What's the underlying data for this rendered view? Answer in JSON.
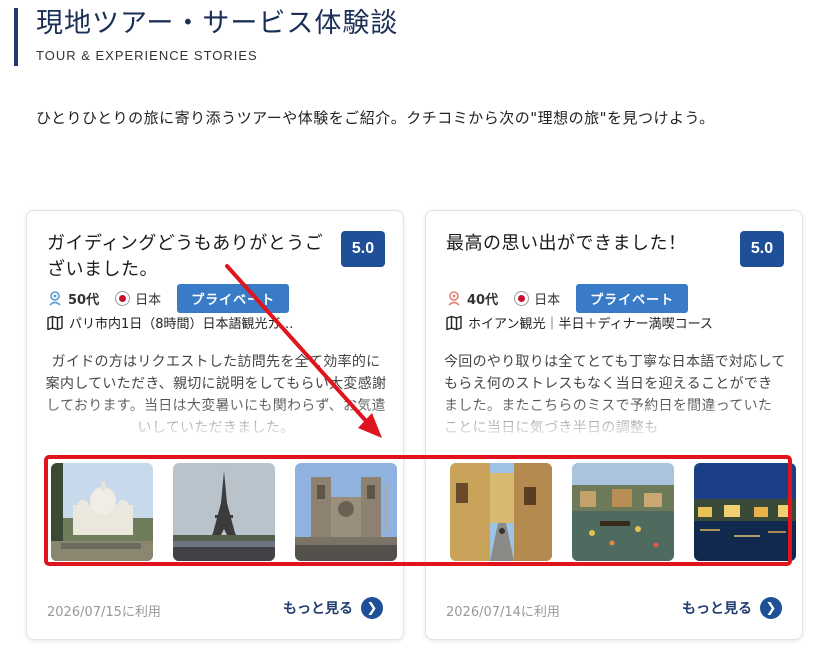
{
  "header": {
    "title": "現地ツアー・サービス体験談",
    "subtitle": "TOUR & EXPERIENCE STORIES"
  },
  "intro": "ひとりひとりの旅に寄り添うツアーや体験をご紹介。クチコミから次の\"理想の旅\"を見つけよう。",
  "cards": [
    {
      "title": "ガイディングどうもありがとうございました。",
      "score": "5.0",
      "age": "50代",
      "nationality": "日本",
      "badge": "プライベート",
      "tour": "パリ市内1日（8時間）日本語観光ガ…",
      "review": "ガイドの方はリクエストした訪問先を全て効率的に案内していただき、親切に説明をしてもらい大変感謝しております。当日は大変暑いにも関わらず、お気遣いしていただきました。",
      "photos": [
        "sacre-coeur",
        "eiffel-tower",
        "notre-dame"
      ],
      "date": "2026/07/15に利用",
      "more_label": "もっと見る",
      "icon_color": "#5b9bd5"
    },
    {
      "title": "最高の思い出ができました！",
      "score": "5.0",
      "age": "40代",
      "nationality": "日本",
      "badge": "プライベート",
      "tour": "ホイアン観光｜半日＋ディナー満喫コース",
      "review": "今回のやり取りは全てとても丁寧な日本語で対応してもらえ何のストレスもなく当日を迎えることができました。またこちらのミスで予約日を間違っていたことに当日に気づき半日の調整も",
      "photos": [
        "hoian-street",
        "hoian-river",
        "hoian-night"
      ],
      "date": "2026/07/14に利用",
      "more_label": "もっと見る",
      "icon_color": "#e88070"
    }
  ],
  "colors": {
    "heading": "#1b2f57",
    "score_bg": "#1f4f96",
    "badge_bg": "#3a7bc8",
    "highlight": "#e0141d"
  }
}
